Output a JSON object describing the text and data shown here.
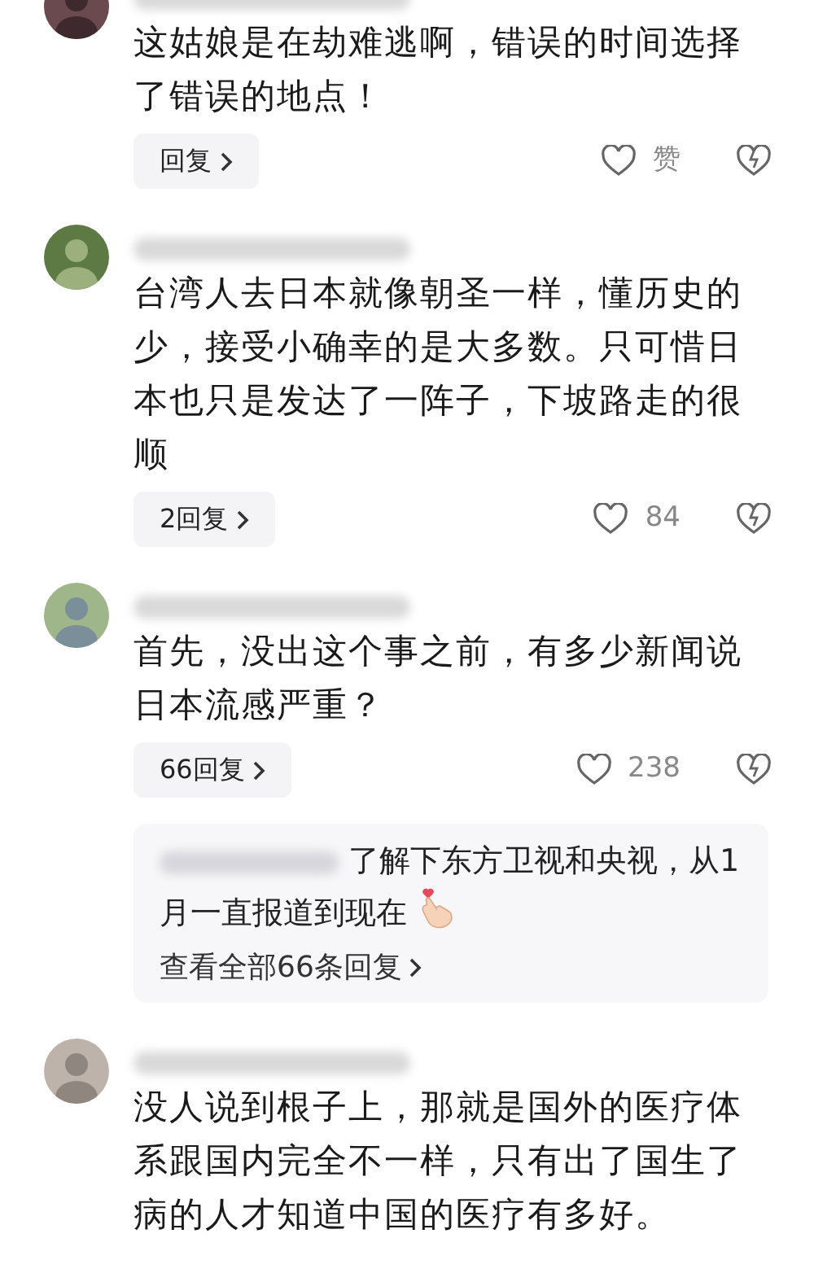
{
  "comments": [
    {
      "text": "这姑娘是在劫难逃啊，错误的时间选择了错误的地点！",
      "reply_label": "回复",
      "like_label": "赞"
    },
    {
      "text": "台湾人去日本就像朝圣一样，懂历史的少，接受小确幸的是大多数。只可惜日本也只是发达了一阵子，下坡路走的很顺",
      "reply_label": "2回复",
      "like_label": "84"
    },
    {
      "text": "首先，没出这个事之前，有多少新闻说日本流感严重？",
      "reply_label": "66回复",
      "like_label": "238",
      "reply_preview": {
        "text": "了解下东方卫视和央视，从1月一直报道到现在",
        "view_all": "查看全部66条回复"
      }
    },
    {
      "text": "没人说到根子上，那就是国外的医疗体系跟国内完全不一样，只有出了国生了病的人才知道中国的医疗有多好。"
    }
  ]
}
